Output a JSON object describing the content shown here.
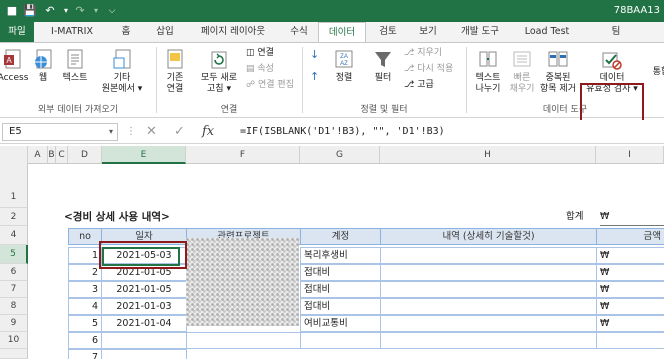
{
  "titlebar": {
    "doc_title": "78BAA13"
  },
  "ribbon_tabs": [
    {
      "label": "파일"
    },
    {
      "label": "I-MATRIX"
    },
    {
      "label": "홈"
    },
    {
      "label": "삽입"
    },
    {
      "label": "페이지 레이아웃"
    },
    {
      "label": "수식"
    },
    {
      "label": "데이터"
    },
    {
      "label": "검토"
    },
    {
      "label": "보기"
    },
    {
      "label": "개발 도구"
    },
    {
      "label": "Load Test"
    },
    {
      "label": "팀"
    }
  ],
  "ribbon": {
    "access": "Access",
    "web": "웹",
    "text": "텍스트",
    "other_1": "기타",
    "other_2": "원본에서",
    "existing_1": "기존",
    "existing_2": "연결",
    "refresh_1": "모두 새로",
    "refresh_2": "고침",
    "connections": "연결",
    "properties": "속성",
    "edit_links": "연결 편집",
    "sort_az": "",
    "sort": "정렬",
    "filter": "필터",
    "clear": "지우기",
    "reapply": "다시 적용",
    "advanced": "고급",
    "text_to_cols_1": "텍스트",
    "text_to_cols_2": "나누기",
    "flash_fill_1": "빠른",
    "flash_fill_2": "채우기",
    "remove_dup_1": "중복된",
    "remove_dup_2": "항목 제거",
    "validation_1": "데이터",
    "validation_2": "유효성 검사",
    "consolidate": "통합",
    "group_external": "외부 데이터 가져오기",
    "group_connections": "연결",
    "group_sort_filter": "정렬 및 필터",
    "group_data_tools": "데이터 도구"
  },
  "formula_bar": {
    "name_box": "E5",
    "fx": "fx",
    "formula": "=IF(ISBLANK('D1'!B3), \"\", 'D1'!B3)"
  },
  "columns": [
    {
      "label": "A"
    },
    {
      "label": "B"
    },
    {
      "label": "C"
    },
    {
      "label": "D"
    },
    {
      "label": "E"
    },
    {
      "label": "F"
    },
    {
      "label": "G"
    },
    {
      "label": "H"
    },
    {
      "label": "I"
    }
  ],
  "rows": [
    "1",
    "2",
    "4",
    "5",
    "6",
    "7",
    "8",
    "9",
    "10"
  ],
  "sheet": {
    "title": "<경비 상세 사용 내역>",
    "total_label": "합계",
    "total_currency": "₩",
    "headers": [
      "no",
      "일자",
      "관련프로젝트",
      "계정",
      "내역 (상세히 기술할것)",
      "금액"
    ],
    "records": [
      {
        "no": "1",
        "date": "2021-05-03",
        "account": "복리후생비",
        "currency": "₩"
      },
      {
        "no": "2",
        "date": "2021-01-05",
        "account": "접대비",
        "currency": "₩"
      },
      {
        "no": "3",
        "date": "2021-01-05",
        "account": "접대비",
        "currency": "₩"
      },
      {
        "no": "4",
        "date": "2021-01-03",
        "account": "접대비",
        "currency": "₩"
      },
      {
        "no": "5",
        "date": "2021-01-04",
        "account": "여비교통비",
        "currency": "₩"
      },
      {
        "no": "6",
        "date": "",
        "account": "",
        "currency": ""
      },
      {
        "no": "7",
        "date": "",
        "account": "",
        "currency": ""
      }
    ]
  },
  "colors": {
    "excel_green": "#217346",
    "highlight_red": "#8e1b1b",
    "table_header_bg": "#dbe5f1"
  }
}
